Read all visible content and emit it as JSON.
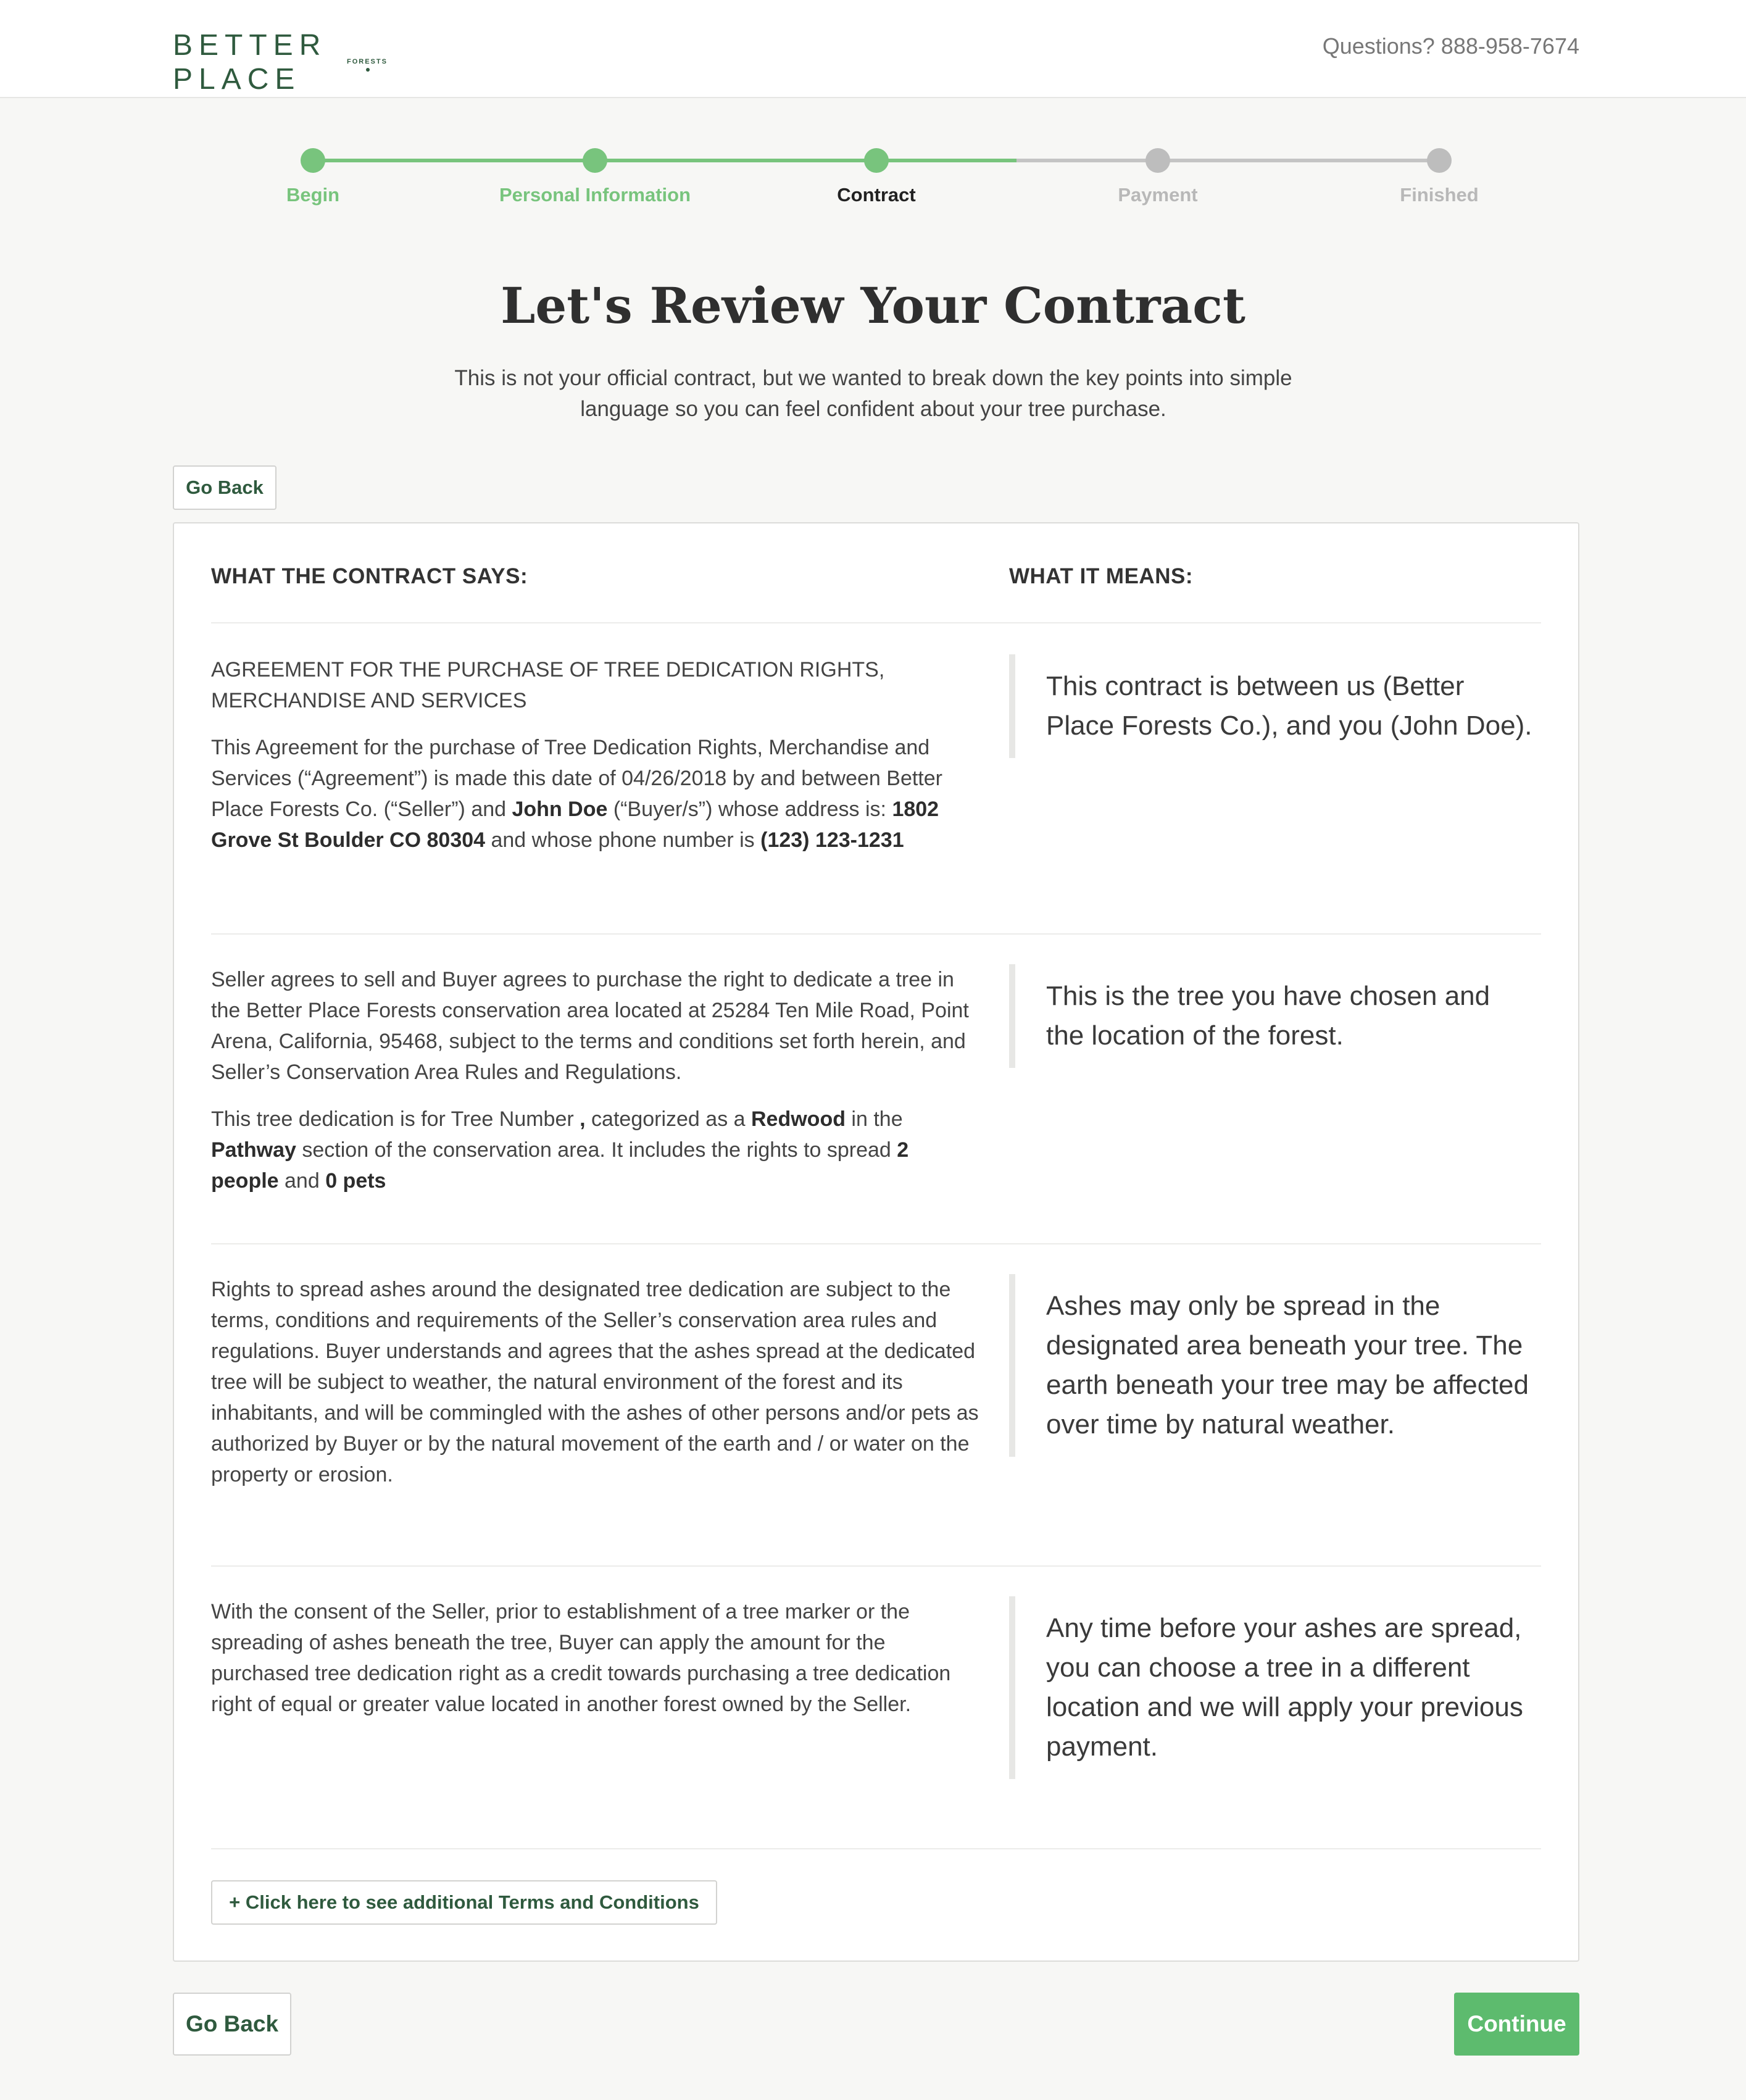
{
  "header": {
    "logo_main": "BETTER PLACE",
    "logo_sub": "FORESTS",
    "phone": "Questions? 888-958-7674"
  },
  "progress": {
    "steps": [
      {
        "label": "Begin",
        "state": "done"
      },
      {
        "label": "Personal Information",
        "state": "done"
      },
      {
        "label": "Contract",
        "state": "current"
      },
      {
        "label": "Payment",
        "state": "todo"
      },
      {
        "label": "Finished",
        "state": "todo"
      }
    ],
    "colors": {
      "done": "#78c47d",
      "current_text": "#222222",
      "todo": "#bdbdbd"
    }
  },
  "page": {
    "title": "Let's Review Your Contract",
    "intro": "This is not your official contract, but we wanted to break down the key points into simple language so you can feel confident about your tree purchase."
  },
  "buttons": {
    "go_back": "Go Back",
    "terms": "+ Click here to see additional Terms and Conditions",
    "continue": "Continue"
  },
  "contract": {
    "left_heading": "WHAT THE CONTRACT SAYS:",
    "right_heading": "WHAT IT MEANS:",
    "s1": {
      "heading": "AGREEMENT FOR THE PURCHASE OF TREE DEDICATION RIGHTS, MERCHANDISE AND SERVICES",
      "t1": "This Agreement for the purchase of Tree Dedication Rights, Merchandise and Services (“Agreement”) is made this date of 04/26/2018 by and between Better Place Forests Co. (“Seller”) and ",
      "buyer": "John Doe",
      "t2": " (“Buyer/s”) whose address is: ",
      "address": "1802 Grove St Boulder CO 80304",
      "t3": " and whose phone number is ",
      "phone": "(123) 123-1231",
      "meaning": "This contract is between us (Better Place Forests Co.), and you (John Doe)."
    },
    "s2": {
      "p1": "Seller agrees to sell and Buyer agrees to purchase the right to dedicate a tree in the Better Place Forests conservation area located at 25284 Ten Mile Road, Point Arena, California, 95468, subject to the terms and conditions set forth herein, and Seller’s Conservation Area Rules and Regulations.",
      "t1": "This tree dedication is for Tree Number ",
      "tree_number": ",",
      "t2": " categorized as a ",
      "species": "Redwood",
      "t3": " in the ",
      "section": "Pathway",
      "t4": " section of the conservation area. It includes the rights to spread ",
      "people": "2 people",
      "t5": " and ",
      "pets": "0 pets",
      "meaning": "This is the tree you have chosen and the location of the forest."
    },
    "s3": {
      "p1": "Rights to spread ashes around the designated tree dedication are subject to the terms, conditions and requirements of the Seller’s conservation area rules and regulations. Buyer understands and agrees that the ashes spread at the dedicated tree will be subject to weather, the natural environment of the forest and its inhabitants, and will be commingled with the ashes of other persons and/or pets as authorized by Buyer or by the natural movement of the earth and / or water on the property or erosion.",
      "meaning": "Ashes may only be spread in the designated area beneath your tree. The earth beneath your tree may be affected over time by natural weather."
    },
    "s4": {
      "p1": "With the consent of the Seller, prior to establishment of a tree marker or the spreading of ashes beneath the tree, Buyer can apply the amount for the purchased tree dedication right as a credit towards purchasing a tree dedication right of equal or greater value located in another forest owned by the Seller.",
      "meaning": "Any time before your ashes are spread, you can choose a tree in a different location and we will apply your previous payment."
    }
  }
}
